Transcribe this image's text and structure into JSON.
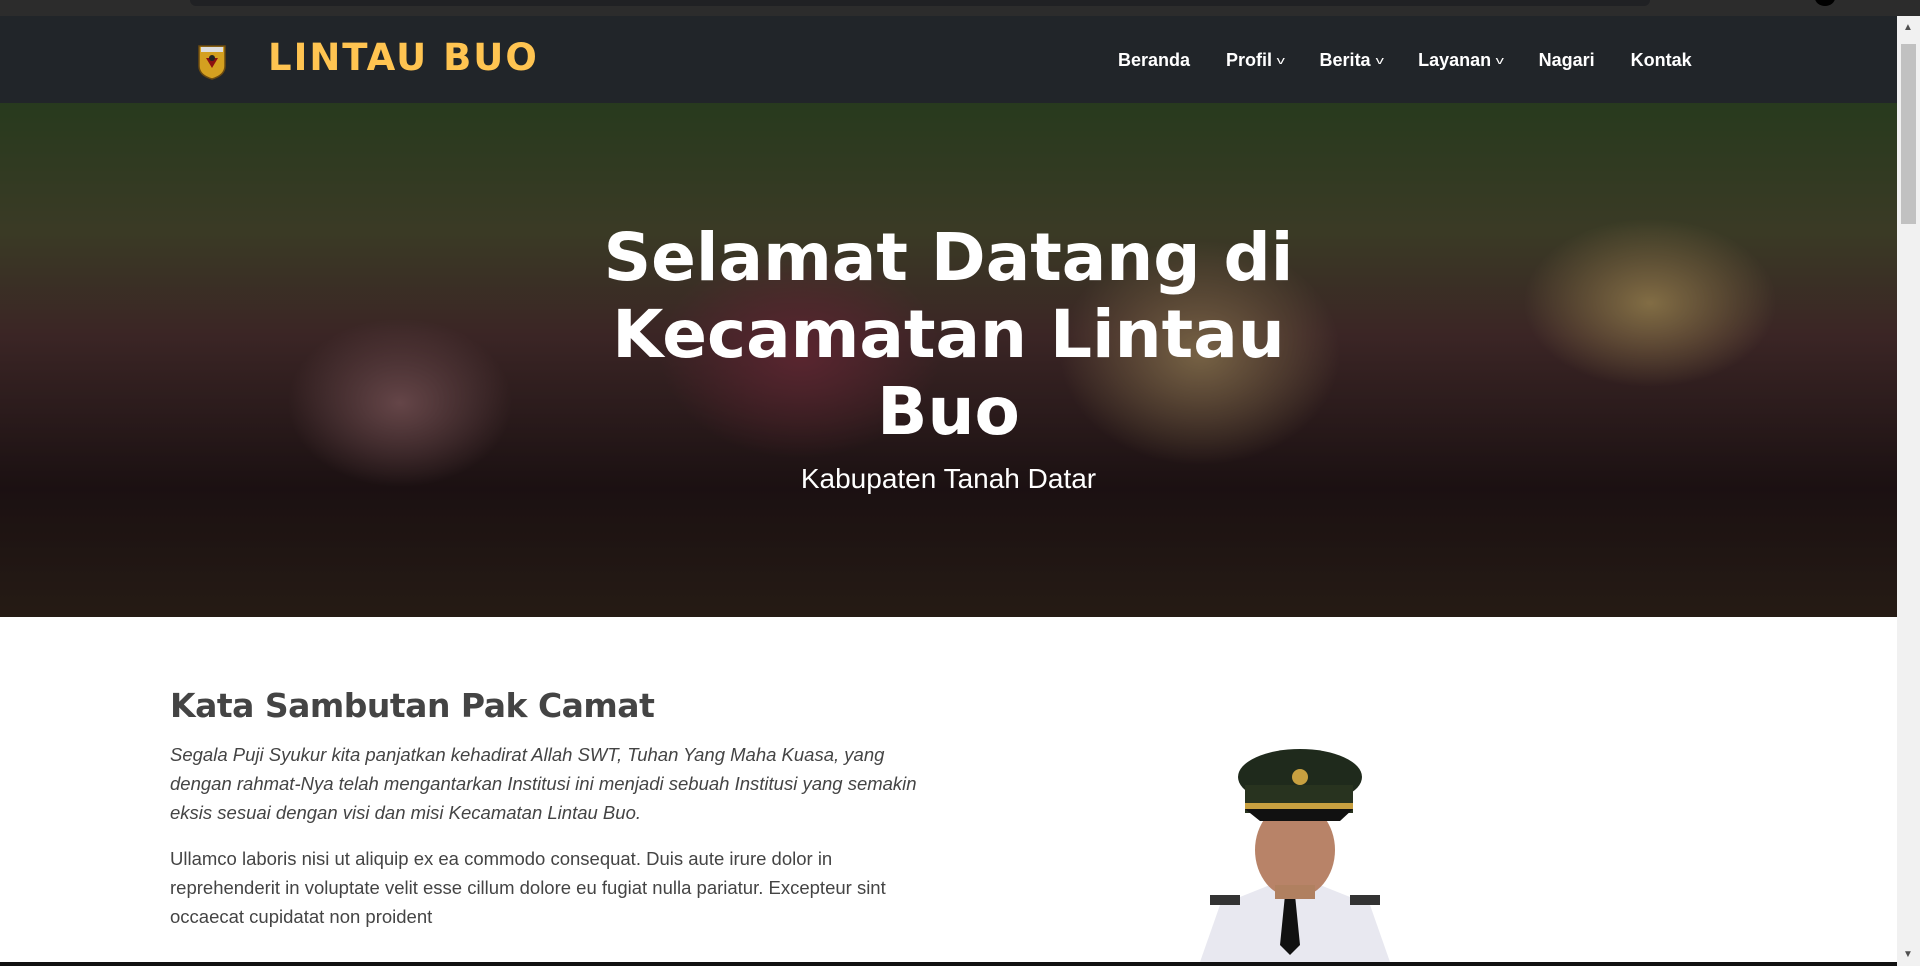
{
  "header": {
    "brand": "LINTAU BUO",
    "nav": [
      {
        "label": "Beranda",
        "dropdown": false
      },
      {
        "label": "Profil",
        "dropdown": true
      },
      {
        "label": "Berita",
        "dropdown": true
      },
      {
        "label": "Layanan",
        "dropdown": true
      },
      {
        "label": "Nagari",
        "dropdown": false
      },
      {
        "label": "Kontak",
        "dropdown": false
      }
    ],
    "brand_color": "#ffc451"
  },
  "hero": {
    "title": "Selamat Datang di Kecamatan Lintau Buo",
    "subtitle": "Kabupaten Tanah Datar"
  },
  "sambutan": {
    "title": "Kata Sambutan Pak Camat",
    "intro": "Segala Puji Syukur kita panjatkan kehadirat Allah SWT, Tuhan Yang Maha Kuasa, yang dengan rahmat-Nya telah mengantarkan Institusi ini menjadi sebuah Institusi yang semakin eksis sesuai dengan visi dan misi Kecamatan Lintau Buo.",
    "body": "Ullamco laboris nisi ut aliquip ex ea commodo consequat. Duis aute irure dolor in reprehenderit in voluptate velit esse cillum dolore eu fugiat nulla pariatur. Excepteur sint occaecat cupidatat non proident"
  }
}
